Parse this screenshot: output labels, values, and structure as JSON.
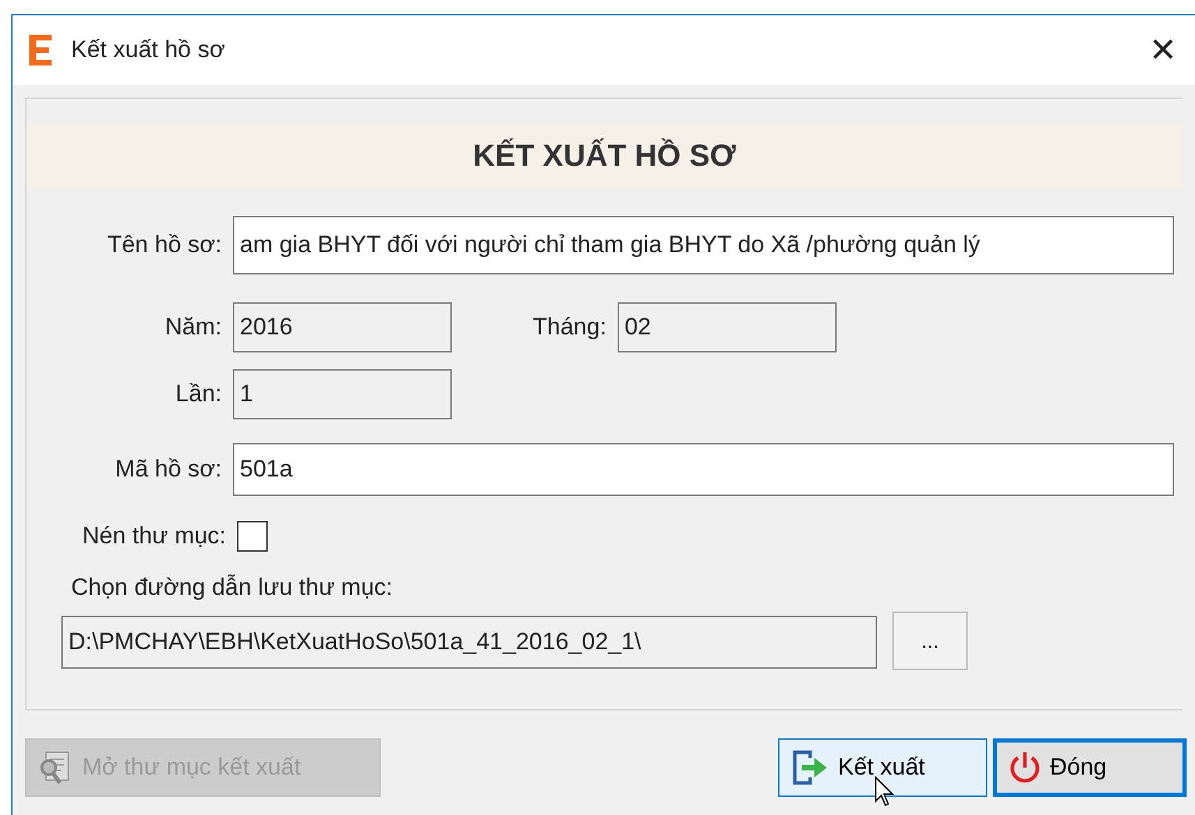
{
  "window": {
    "title": "Kết xuất hồ sơ",
    "close": "✕"
  },
  "heading": "KẾT XUẤT HỒ SƠ",
  "name_field": {
    "label": "Tên hồ sơ:",
    "value": "am gia BHYT đối với người chỉ tham gia BHYT do Xã /phường quản lý"
  },
  "year_field": {
    "label": "Năm:",
    "value": "2016"
  },
  "month_field": {
    "label": "Tháng:",
    "value": "02"
  },
  "count_field": {
    "label": "Lần:",
    "value": "1"
  },
  "code_field": {
    "label": "Mã hồ sơ:",
    "value": "501a"
  },
  "compress": {
    "label": "Nén thư mục:",
    "checked": false
  },
  "path": {
    "label": "Chọn đường dẫn lưu thư mục:",
    "value": "D:\\PMCHAY\\EBH\\KetXuatHoSo\\501a_41_2016_02_1\\",
    "browse": "..."
  },
  "buttons": [
    {
      "kind": "open",
      "label": "Mở thư mục kết xuất",
      "disabled": true,
      "hovered": false,
      "default": false
    },
    {
      "kind": "export",
      "label": "Kết xuất",
      "disabled": false,
      "hovered": true,
      "default": false
    },
    {
      "kind": "close",
      "label": "Đóng",
      "disabled": false,
      "hovered": false,
      "default": true
    }
  ]
}
